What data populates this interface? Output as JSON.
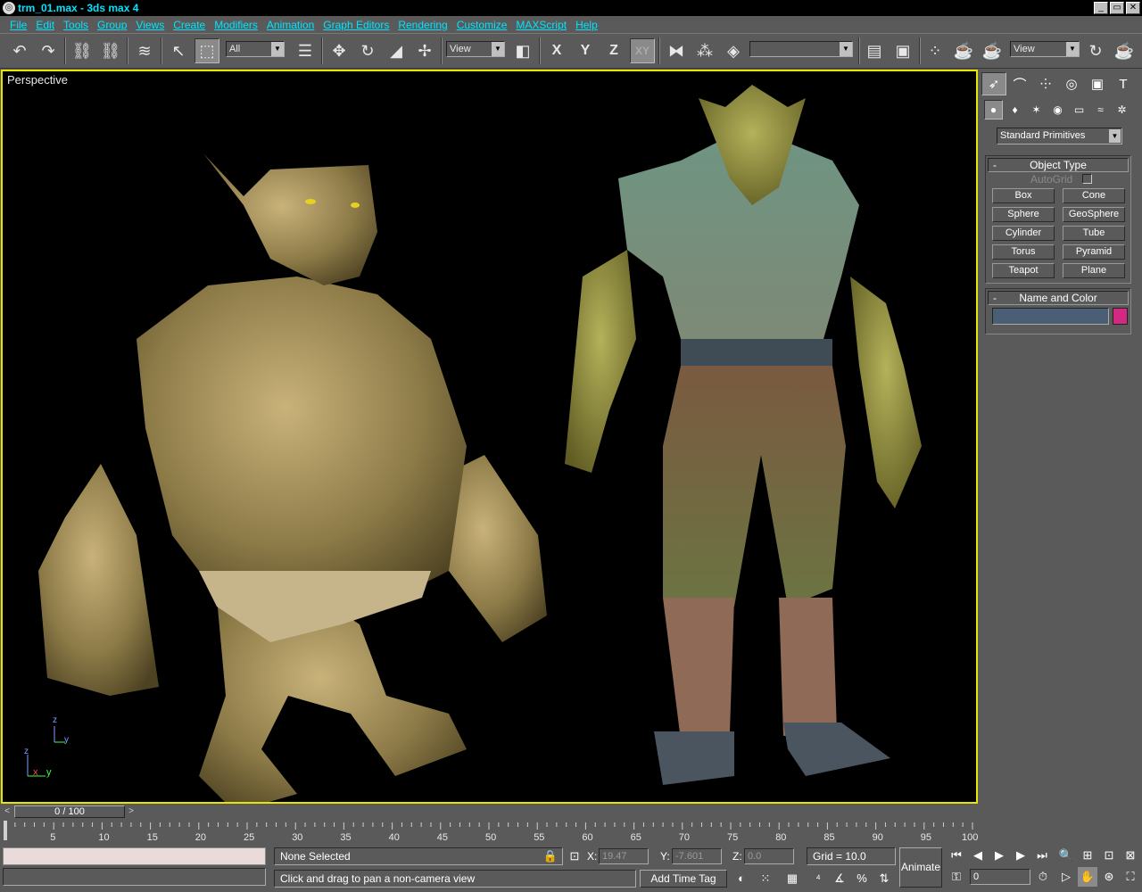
{
  "window": {
    "title": "trm_01.max - 3ds max 4",
    "controls": [
      "_",
      "▭",
      "✕"
    ]
  },
  "menu": [
    "File",
    "Edit",
    "Tools",
    "Group",
    "Views",
    "Create",
    "Modifiers",
    "Animation",
    "Graph Editors",
    "Rendering",
    "Customize",
    "MAXScript",
    "Help"
  ],
  "toolbar": {
    "selection_filter": "All",
    "ref_coord": "View",
    "axis_x": "X",
    "axis_y": "Y",
    "axis_z": "Z",
    "axis_xy": "XY",
    "named_selection": "",
    "render_view": "View"
  },
  "viewport": {
    "label": "Perspective",
    "axis_z": "z",
    "axis_x": "x",
    "axis_y": "y"
  },
  "command_panel": {
    "category": "Standard Primitives",
    "object_type": {
      "header": "Object Type",
      "autogrid": "AutoGrid",
      "autogrid_checked": false,
      "buttons": [
        "Box",
        "Cone",
        "Sphere",
        "GeoSphere",
        "Cylinder",
        "Tube",
        "Torus",
        "Pyramid",
        "Teapot",
        "Plane"
      ]
    },
    "name_and_color": {
      "header": "Name and Color",
      "name_value": "",
      "color": "#d22a82"
    }
  },
  "timeline": {
    "slider_text": "0 / 100",
    "ticks": [
      "5",
      "10",
      "15",
      "20",
      "25",
      "30",
      "35",
      "40",
      "45",
      "50",
      "55",
      "60",
      "65",
      "70",
      "75",
      "80",
      "85",
      "90",
      "95",
      "100"
    ]
  },
  "status": {
    "selection": "None Selected",
    "prompt": "Click and drag to pan a non-camera view",
    "x_label": "X:",
    "x_value": "19.47",
    "y_label": "Y:",
    "y_value": "-7.601",
    "z_label": "Z:",
    "z_value": "0.0",
    "grid": "Grid = 10.0",
    "add_time_tag": "Add Time Tag",
    "animate": "Animate",
    "frame": "0"
  },
  "colors": {
    "viewport_border": "#e6e600",
    "menu_text": "#00e5ff",
    "ui_gray": "#5a5a5a"
  }
}
